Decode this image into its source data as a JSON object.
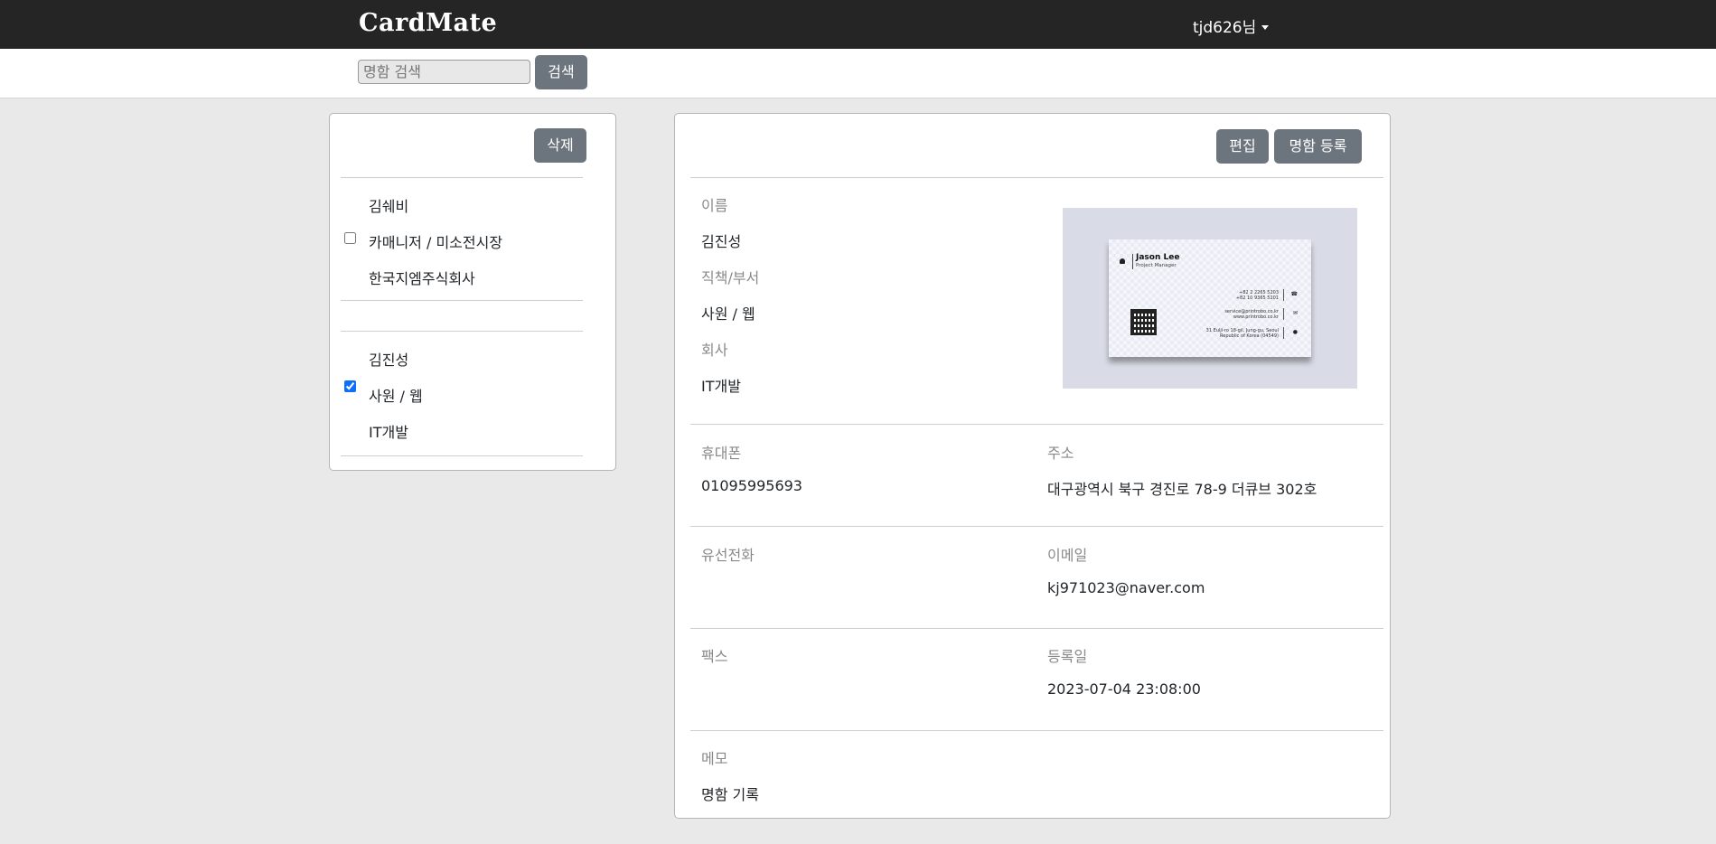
{
  "header": {
    "brand": "CardMate",
    "user_label": "tjd626님"
  },
  "search": {
    "placeholder": "명함 검색",
    "button_label": "검색"
  },
  "card_list": {
    "delete_label": "삭제",
    "items": [
      {
        "name": "김쉐비",
        "position": "카매니저 / 미소전시장",
        "company": "한국지엠주식회사",
        "checked": false
      },
      {
        "name": "김진성",
        "position": "사원 / 웹",
        "company": "IT개발",
        "checked": true
      }
    ]
  },
  "detail": {
    "edit_label": "편집",
    "register_label": "명함 등록",
    "name_label": "이름",
    "name_value": "김진성",
    "position_label": "직책/부서",
    "position_value": "사원 / 웹",
    "company_label": "회사",
    "company_value": "IT개발",
    "mobile_label": "휴대폰",
    "mobile_value": "01095995693",
    "address_label": "주소",
    "address_value": "대구광역시 북구 경진로 78-9 더큐브 302호",
    "landline_label": "유선전화",
    "landline_value": "",
    "email_label": "이메일",
    "email_value": "kj971023@naver.com",
    "fax_label": "팩스",
    "fax_value": "",
    "registered_label": "등록일",
    "registered_value": "2023-07-04 23:08:00",
    "memo_label": "메모",
    "memo_value": "명함 기록"
  },
  "card_image": {
    "name": "Jason Lee",
    "title": "Project Manager",
    "phone1": "+82 2 2265 5203",
    "phone2": "+82 10 9365 5201",
    "email1": "service@printrobo.co.kr",
    "email2": "www.printrobo.co.kr",
    "address1": "31 Eulji-ro 18-gil, Jung-gu, Seoul",
    "address2": "Republic of Korea (04549)"
  }
}
